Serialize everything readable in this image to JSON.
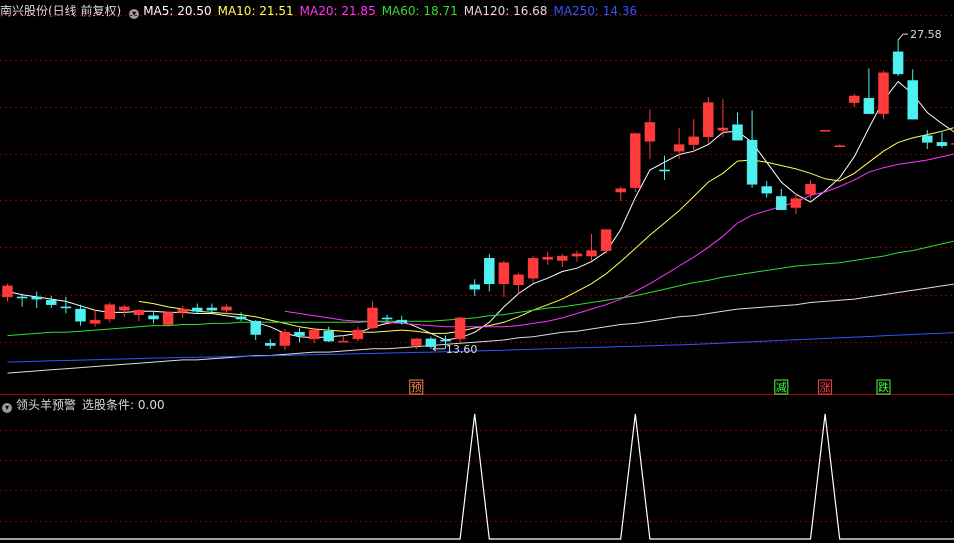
{
  "stock": {
    "title": "南兴股份(日线 前复权)"
  },
  "ma_legend": [
    {
      "label": "MA5: 20.50",
      "color": "#ffffff"
    },
    {
      "label": "MA10: 21.51",
      "color": "#ffff55"
    },
    {
      "label": "MA20: 21.85",
      "color": "#ff33ff"
    },
    {
      "label": "MA60: 18.71",
      "color": "#33dd33"
    },
    {
      "label": "MA120: 16.68",
      "color": "#dddddd"
    },
    {
      "label": "MA250: 14.36",
      "color": "#3355ff"
    }
  ],
  "indicator": {
    "name": "领头羊预警",
    "condition": "选股条件: 0.00"
  },
  "colors": {
    "up": "#ff3a3a",
    "down": "#4ff0f0",
    "grid": "#7a0000",
    "signal": "#ffffff"
  },
  "chart_data": [
    {
      "type": "candlestick",
      "title": "南兴股份(日线 前复权)",
      "ylim": [
        11.6,
        28.4
      ],
      "grid": true,
      "candles": [
        [
          15.95,
          16.55,
          15.75,
          16.45
        ],
        [
          15.95,
          16.1,
          15.5,
          15.9
        ],
        [
          15.95,
          16.2,
          15.45,
          15.85
        ],
        [
          15.8,
          16.0,
          15.45,
          15.6
        ],
        [
          15.5,
          15.95,
          15.2,
          15.45
        ],
        [
          15.4,
          15.6,
          14.65,
          14.85
        ],
        [
          14.75,
          15.35,
          14.6,
          14.9
        ],
        [
          14.95,
          15.7,
          14.8,
          15.6
        ],
        [
          15.35,
          15.6,
          15.05,
          15.5
        ],
        [
          15.15,
          15.4,
          14.85,
          15.35
        ],
        [
          15.1,
          15.3,
          14.75,
          14.95
        ],
        [
          14.7,
          15.3,
          14.6,
          15.25
        ],
        [
          15.25,
          15.55,
          15.0,
          15.4
        ],
        [
          15.45,
          15.65,
          15.2,
          15.3
        ],
        [
          15.45,
          15.65,
          15.25,
          15.35
        ],
        [
          15.35,
          15.6,
          15.15,
          15.5
        ],
        [
          15.05,
          15.25,
          14.85,
          14.95
        ],
        [
          14.85,
          14.9,
          14.0,
          14.25
        ],
        [
          13.85,
          14.05,
          13.6,
          13.75
        ],
        [
          13.75,
          14.5,
          13.55,
          14.35
        ],
        [
          14.35,
          14.55,
          13.9,
          14.2
        ],
        [
          14.05,
          14.55,
          13.85,
          14.45
        ],
        [
          14.4,
          14.6,
          13.9,
          13.95
        ],
        [
          13.95,
          14.2,
          13.9,
          13.95
        ],
        [
          14.05,
          14.6,
          13.95,
          14.45
        ],
        [
          14.55,
          15.75,
          14.5,
          15.45
        ],
        [
          15.0,
          15.15,
          14.8,
          14.95
        ],
        [
          14.9,
          15.1,
          14.7,
          14.8
        ],
        [
          13.75,
          14.1,
          13.6,
          14.05
        ],
        [
          14.05,
          14.15,
          13.6,
          13.7
        ],
        [
          14.0,
          14.2,
          13.6,
          13.95
        ],
        [
          14.05,
          15.05,
          13.9,
          15.0
        ],
        [
          16.5,
          16.75,
          16.0,
          16.3
        ],
        [
          17.7,
          17.9,
          16.2,
          16.55
        ],
        [
          16.55,
          17.6,
          15.95,
          17.5
        ],
        [
          16.5,
          17.05,
          16.1,
          16.95
        ],
        [
          16.8,
          17.8,
          16.6,
          17.7
        ],
        [
          17.65,
          18.0,
          17.4,
          17.75
        ],
        [
          17.6,
          17.9,
          17.3,
          17.8
        ],
        [
          17.8,
          18.05,
          17.55,
          17.9
        ],
        [
          17.8,
          18.8,
          17.6,
          18.05
        ],
        [
          18.05,
          18.8,
          17.9,
          19.0
        ],
        [
          20.7,
          20.95,
          20.3,
          20.85
        ],
        [
          20.9,
          23.4,
          20.7,
          23.35
        ],
        [
          23.0,
          24.45,
          22.2,
          23.85
        ],
        [
          21.7,
          22.35,
          21.25,
          21.65
        ],
        [
          22.55,
          23.6,
          22.2,
          22.85
        ],
        [
          22.85,
          24.0,
          22.5,
          23.2
        ],
        [
          23.2,
          25.0,
          22.9,
          24.75
        ],
        [
          23.5,
          24.9,
          23.2,
          23.6
        ],
        [
          23.75,
          24.3,
          23.05,
          23.05
        ],
        [
          23.05,
          24.4,
          20.9,
          21.05
        ],
        [
          20.95,
          21.2,
          20.45,
          20.65
        ],
        [
          20.5,
          20.85,
          19.9,
          19.9
        ],
        [
          20.0,
          20.65,
          19.7,
          20.4
        ],
        [
          20.6,
          21.25,
          20.4,
          21.05
        ],
        [
          23.45,
          23.5,
          23.45,
          23.5
        ],
        [
          22.75,
          22.85,
          22.75,
          22.8
        ],
        [
          24.75,
          25.15,
          24.55,
          25.05
        ],
        [
          24.95,
          26.3,
          24.4,
          24.25
        ],
        [
          24.25,
          26.2,
          24.0,
          26.1
        ],
        [
          27.05,
          27.6,
          25.95,
          26.05
        ],
        [
          25.75,
          26.25,
          24.1,
          24.0
        ],
        [
          23.25,
          23.5,
          22.65,
          22.95
        ],
        [
          22.95,
          23.4,
          22.7,
          22.8
        ],
        [
          22.9,
          23.75,
          22.7,
          22.9
        ],
        [
          23.2,
          23.6,
          22.6,
          22.85
        ]
      ],
      "series": [
        {
          "name": "MA5",
          "values": [
            16.2,
            16.05,
            15.95,
            15.85,
            15.75,
            15.55,
            15.35,
            15.25,
            15.25,
            15.3,
            15.3,
            15.25,
            15.25,
            15.2,
            15.2,
            15.1,
            15.0,
            14.8,
            14.6,
            14.3,
            14.15,
            14.1,
            14.15,
            14.2,
            14.3,
            14.6,
            14.75,
            14.85,
            14.6,
            14.3,
            14.0,
            14.1,
            14.35,
            14.8,
            15.5,
            16.1,
            16.55,
            16.8,
            17.1,
            17.25,
            17.55,
            18.0,
            19.0,
            20.45,
            21.7,
            22.05,
            22.4,
            22.55,
            22.85,
            23.4,
            23.45,
            22.95,
            22.05,
            21.15,
            20.6,
            20.25,
            20.75,
            21.35,
            22.3,
            23.6,
            24.85,
            25.7,
            25.15,
            24.3,
            23.8,
            23.35,
            23.1
          ]
        },
        {
          "name": "MA10",
          "values": [
            null,
            null,
            null,
            null,
            null,
            null,
            null,
            null,
            null,
            15.75,
            15.65,
            15.5,
            15.4,
            15.3,
            15.25,
            15.2,
            15.15,
            15.05,
            14.9,
            14.75,
            14.6,
            14.5,
            14.45,
            14.4,
            14.35,
            14.35,
            14.4,
            14.45,
            14.4,
            14.3,
            14.3,
            14.4,
            14.55,
            14.65,
            14.8,
            15.05,
            15.35,
            15.6,
            15.85,
            16.2,
            16.55,
            17.0,
            17.55,
            18.15,
            18.75,
            19.3,
            19.85,
            20.5,
            21.15,
            21.55,
            22.1,
            22.15,
            22.05,
            21.9,
            21.75,
            21.55,
            21.3,
            21.2,
            21.55,
            22.05,
            22.55,
            22.95,
            23.15,
            23.3,
            23.45,
            23.65,
            23.85
          ]
        },
        {
          "name": "MA20",
          "values": [
            null,
            null,
            null,
            null,
            null,
            null,
            null,
            null,
            null,
            null,
            null,
            null,
            null,
            null,
            null,
            null,
            null,
            null,
            null,
            15.3,
            15.2,
            15.1,
            15.0,
            14.9,
            14.85,
            14.85,
            14.8,
            14.75,
            14.7,
            14.65,
            14.6,
            14.6,
            14.6,
            14.6,
            14.6,
            14.65,
            14.75,
            14.85,
            15.0,
            15.2,
            15.4,
            15.6,
            15.85,
            16.2,
            16.55,
            16.95,
            17.35,
            17.75,
            18.2,
            18.7,
            19.3,
            19.65,
            19.85,
            20.05,
            20.25,
            20.55,
            20.7,
            20.95,
            21.25,
            21.6,
            21.8,
            21.95,
            22.05,
            22.15,
            22.3,
            22.45,
            22.6
          ]
        },
        {
          "name": "MA60",
          "values": [
            14.2,
            14.25,
            14.3,
            14.35,
            14.35,
            14.4,
            14.45,
            14.5,
            14.55,
            14.6,
            14.65,
            14.65,
            14.7,
            14.7,
            14.75,
            14.75,
            14.8,
            14.8,
            14.8,
            14.8,
            14.8,
            14.8,
            14.8,
            14.8,
            14.8,
            14.85,
            14.85,
            14.85,
            14.85,
            14.85,
            14.9,
            14.95,
            15.0,
            15.1,
            15.15,
            15.25,
            15.35,
            15.45,
            15.5,
            15.6,
            15.7,
            15.8,
            15.9,
            16.0,
            16.15,
            16.3,
            16.45,
            16.6,
            16.7,
            16.85,
            16.95,
            17.05,
            17.15,
            17.25,
            17.35,
            17.4,
            17.45,
            17.5,
            17.6,
            17.7,
            17.8,
            17.95,
            18.05,
            18.2,
            18.35,
            18.5,
            18.65
          ]
        },
        {
          "name": "MA120",
          "values": [
            12.5,
            12.55,
            12.6,
            12.65,
            12.7,
            12.75,
            12.8,
            12.85,
            12.9,
            12.95,
            13.0,
            13.05,
            13.1,
            13.1,
            13.15,
            13.2,
            13.25,
            13.3,
            13.3,
            13.35,
            13.4,
            13.45,
            13.45,
            13.5,
            13.55,
            13.6,
            13.6,
            13.65,
            13.7,
            13.75,
            13.8,
            13.85,
            13.9,
            13.95,
            14.0,
            14.1,
            14.15,
            14.25,
            14.35,
            14.4,
            14.5,
            14.6,
            14.7,
            14.75,
            14.85,
            14.95,
            15.05,
            15.1,
            15.2,
            15.3,
            15.4,
            15.45,
            15.5,
            15.55,
            15.6,
            15.7,
            15.75,
            15.8,
            15.85,
            15.95,
            16.05,
            16.15,
            16.25,
            16.35,
            16.45,
            16.55,
            16.65
          ]
        },
        {
          "name": "MA250",
          "values": [
            13.0,
            13.02,
            13.04,
            13.06,
            13.07,
            13.09,
            13.11,
            13.13,
            13.14,
            13.16,
            13.18,
            13.19,
            13.21,
            13.22,
            13.23,
            13.25,
            13.26,
            13.27,
            13.29,
            13.3,
            13.32,
            13.33,
            13.35,
            13.36,
            13.38,
            13.39,
            13.41,
            13.42,
            13.44,
            13.45,
            13.47,
            13.48,
            13.5,
            13.52,
            13.54,
            13.56,
            13.58,
            13.6,
            13.62,
            13.64,
            13.66,
            13.68,
            13.7,
            13.72,
            13.74,
            13.76,
            13.78,
            13.8,
            13.83,
            13.86,
            13.89,
            13.92,
            13.95,
            13.98,
            14.01,
            14.04,
            14.07,
            14.1,
            14.13,
            14.16,
            14.19,
            14.22,
            14.25,
            14.28,
            14.31,
            14.34,
            14.36
          ]
        }
      ],
      "annotations": [
        {
          "text": "27.58",
          "index": 61,
          "value": 27.58
        },
        {
          "text": "13.60",
          "index": 29,
          "value": 13.6
        }
      ],
      "markers": [
        {
          "text": "预",
          "index": 28,
          "color": "#ff8844",
          "border": "#ff8844"
        },
        {
          "text": "减",
          "index": 53,
          "color": "#44ff44",
          "border": "#44ff44"
        },
        {
          "text": "涨",
          "index": 56,
          "color": "#ff4444",
          "border": "#ff4444"
        },
        {
          "text": "跌",
          "index": 60,
          "color": "#44ff44",
          "border": "#44ff44"
        }
      ]
    },
    {
      "type": "line",
      "title": "领头羊预警",
      "ylim": [
        0,
        1
      ],
      "x_count": 67,
      "signal_indices": [
        32,
        43,
        56
      ],
      "values_note_free": true
    }
  ]
}
